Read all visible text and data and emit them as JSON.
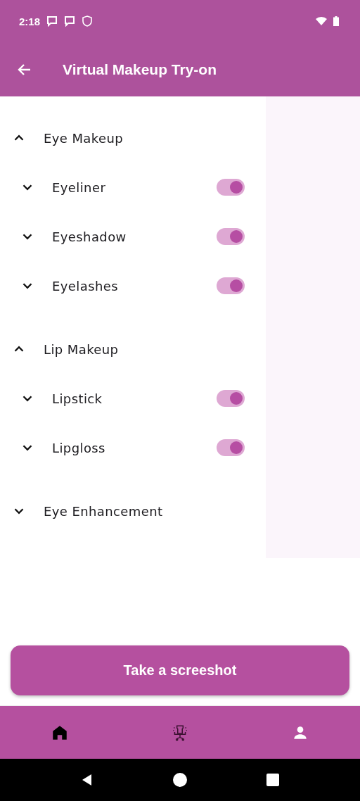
{
  "status_bar": {
    "time": "2:18"
  },
  "app_bar": {
    "title": "Virtual Makeup Try-on"
  },
  "sections": [
    {
      "label": "Eye Makeup",
      "expanded": true,
      "children": [
        {
          "label": "Eyeliner",
          "expanded": false,
          "on": true
        },
        {
          "label": "Eyeshadow",
          "expanded": false,
          "on": true
        },
        {
          "label": "Eyelashes",
          "expanded": false,
          "on": true
        }
      ]
    },
    {
      "label": "Lip Makeup",
      "expanded": true,
      "children": [
        {
          "label": "Lipstick",
          "expanded": false,
          "on": true
        },
        {
          "label": "Lipgloss",
          "expanded": false,
          "on": true
        }
      ]
    },
    {
      "label": "Eye Enhancement",
      "expanded": false
    }
  ],
  "action_button": {
    "label": "Take a screeshot"
  },
  "bottom_nav": [
    {
      "kind": "home",
      "selected": true
    },
    {
      "kind": "chair",
      "selected": false
    },
    {
      "kind": "person",
      "selected": false
    }
  ]
}
